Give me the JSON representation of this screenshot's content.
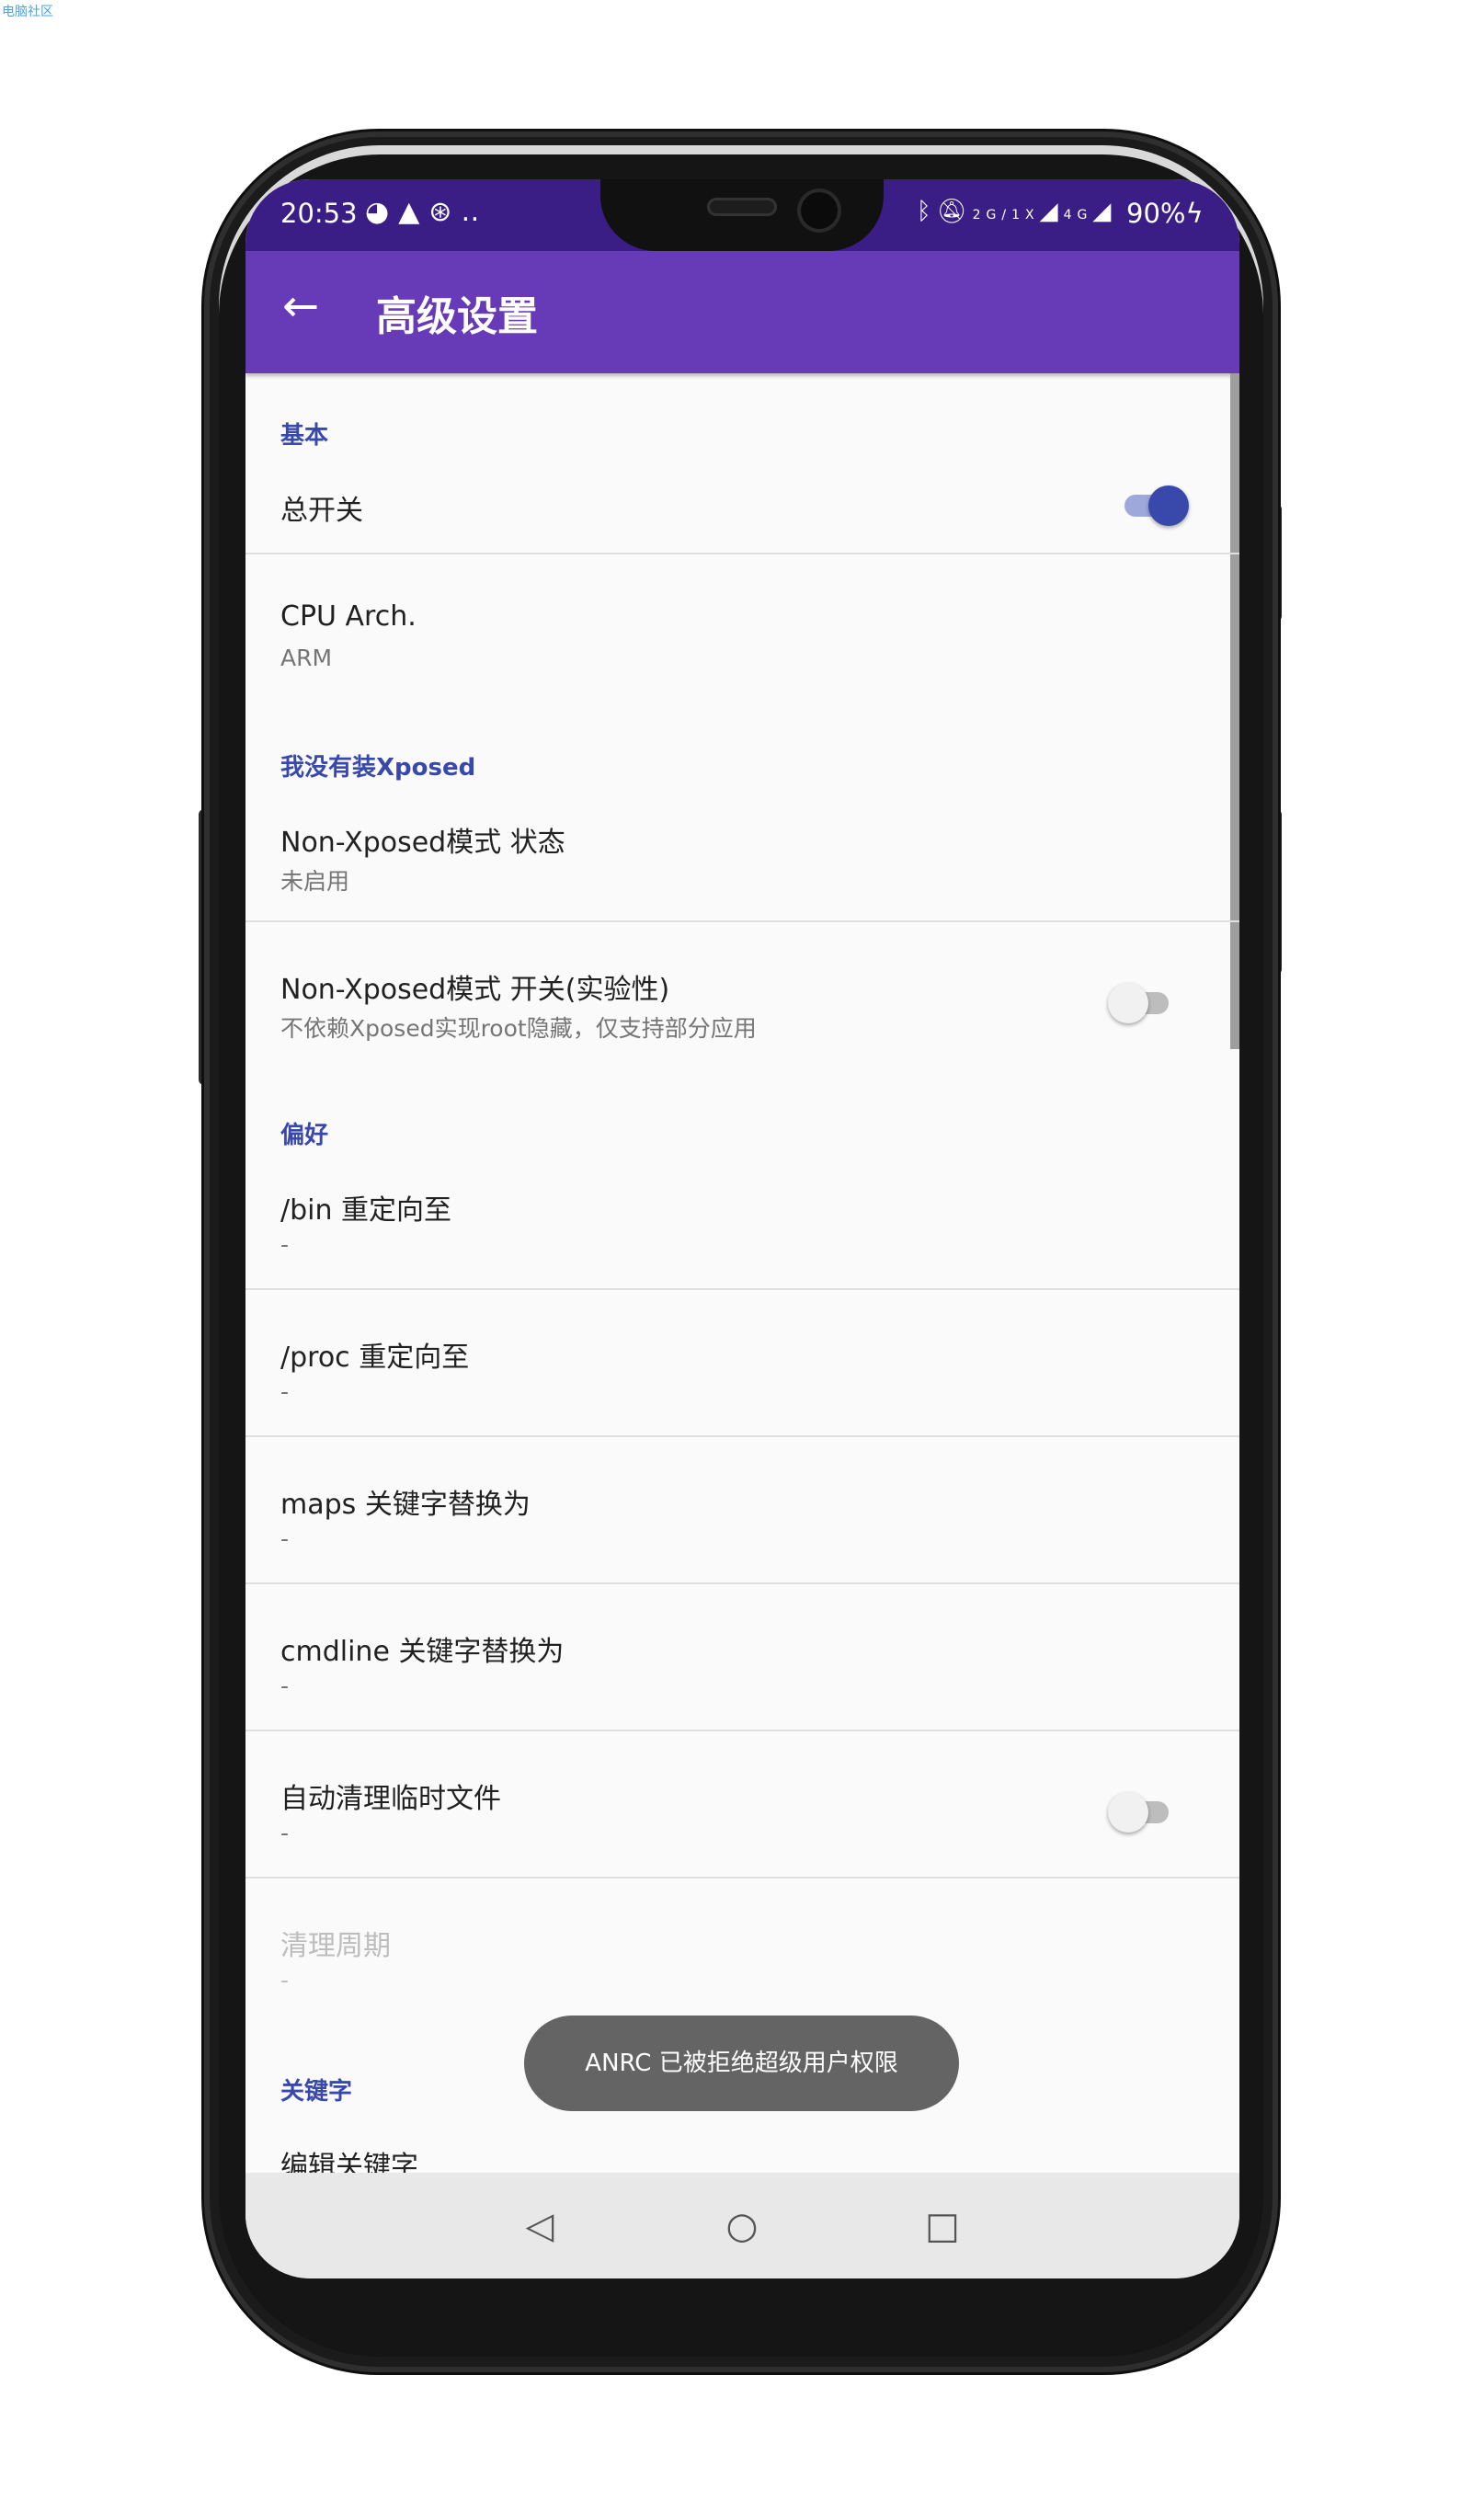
{
  "watermark": "电脑社区",
  "status_bar": {
    "time": "20:53",
    "left_icons": [
      "browser-icon",
      "warning-icon",
      "android-icon",
      "more-icon"
    ],
    "right_icons": [
      "bluetooth-icon",
      "mute-icon",
      "signal-2g-icon",
      "signal-4g-icon"
    ],
    "network_labels": [
      "2G",
      "1X",
      "4G"
    ],
    "battery": "90%"
  },
  "app_bar": {
    "title": "高级设置",
    "back_icon": "back-arrow-icon",
    "color": "#673ab7"
  },
  "sections": {
    "basic": {
      "header": "基本",
      "master_switch": {
        "title": "总开关",
        "checked": true
      },
      "cpu_arch": {
        "title": "CPU Arch.",
        "summary": "ARM"
      }
    },
    "no_xposed": {
      "header": "我没有装Xposed",
      "status": {
        "title": "Non-Xposed模式 状态",
        "summary": "未启用"
      },
      "toggle": {
        "title": "Non-Xposed模式 开关(实验性)",
        "summary": "不依赖Xposed实现root隐藏，仅支持部分应用",
        "checked": false
      }
    },
    "preferences": {
      "header": "偏好",
      "bin_redirect": {
        "title": "/bin 重定向至",
        "summary": "-"
      },
      "proc_redirect": {
        "title": "/proc 重定向至",
        "summary": "-"
      },
      "maps_replace": {
        "title": "maps 关键字替换为",
        "summary": "-"
      },
      "cmdline_replace": {
        "title": "cmdline 关键字替换为",
        "summary": "-"
      },
      "auto_clean": {
        "title": "自动清理临时文件",
        "summary": "-",
        "checked": false
      },
      "clean_period": {
        "title": "清理周期",
        "summary": "-"
      }
    },
    "keywords": {
      "header": "关键字",
      "edit": {
        "title": "编辑关键字"
      }
    }
  },
  "toast": {
    "text": "ANRC 已被拒绝超级用户权限"
  },
  "nav_bar": {
    "back": "◁",
    "home": "○",
    "recents": "□"
  },
  "colors": {
    "accent": "#3949ab",
    "status_bar": "#3a1e86"
  }
}
